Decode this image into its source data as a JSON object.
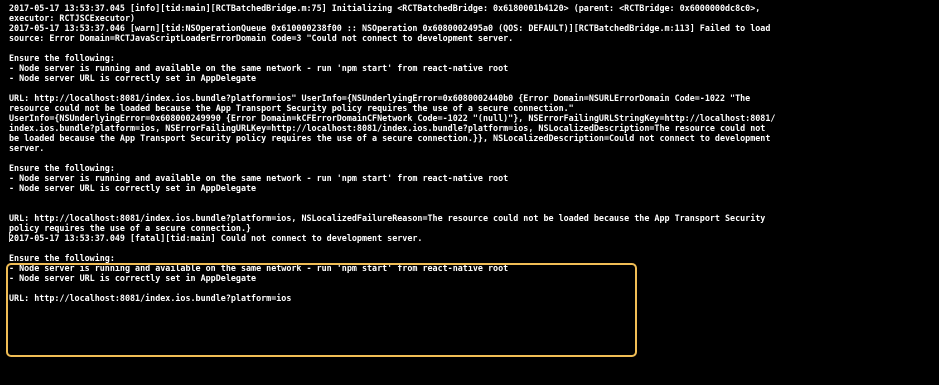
{
  "colors": {
    "background": "#000000",
    "text": "#ffffff",
    "highlight_border": "#f0bd55"
  },
  "console": {
    "lines": [
      "2017-05-17 13:53:37.045 [info][tid:main][RCTBatchedBridge.m:75] Initializing <RCTBatchedBridge: 0x6180001b4120> (parent: <RCTBridge: 0x6000000dc8c0>,",
      "executor: RCTJSCExecutor)",
      "2017-05-17 13:53:37.046 [warn][tid:NSOperationQueue 0x610000238f00 :: NSOperation 0x6080002495a0 (QOS: DEFAULT)][RCTBatchedBridge.m:113] Failed to load",
      "source: Error Domain=RCTJavaScriptLoaderErrorDomain Code=3 \"Could not connect to development server.",
      "",
      "Ensure the following:",
      "- Node server is running and available on the same network - run 'npm start' from react-native root",
      "- Node server URL is correctly set in AppDelegate",
      "",
      "URL: http://localhost:8081/index.ios.bundle?platform=ios\" UserInfo={NSUnderlyingError=0x6080002440b0 {Error Domain=NSURLErrorDomain Code=-1022 \"The",
      "resource could not be loaded because the App Transport Security policy requires the use of a secure connection.\"",
      "UserInfo={NSUnderlyingError=0x608000249990 {Error Domain=kCFErrorDomainCFNetwork Code=-1022 \"(null)\"}, NSErrorFailingURLStringKey=http://localhost:8081/",
      "index.ios.bundle?platform=ios, NSErrorFailingURLKey=http://localhost:8081/index.ios.bundle?platform=ios, NSLocalizedDescription=The resource could not",
      "be loaded because the App Transport Security policy requires the use of a secure connection.}}, NSLocalizedDescription=Could not connect to development",
      "server.",
      "",
      "Ensure the following:",
      "- Node server is running and available on the same network - run 'npm start' from react-native root",
      "- Node server URL is correctly set in AppDelegate",
      "",
      "",
      "URL: http://localhost:8081/index.ios.bundle?platform=ios, NSLocalizedFailureReason=The resource could not be loaded because the App Transport Security",
      "policy requires the use of a secure connection.}",
      "2017-05-17 13:53:37.049 [fatal][tid:main] Could not connect to development server.",
      "",
      "Ensure the following:",
      "- Node server is running and available on the same network - run 'npm start' from react-native root",
      "- Node server URL is correctly set in AppDelegate",
      "",
      "URL: http://localhost:8081/index.ios.bundle?platform=ios"
    ]
  }
}
